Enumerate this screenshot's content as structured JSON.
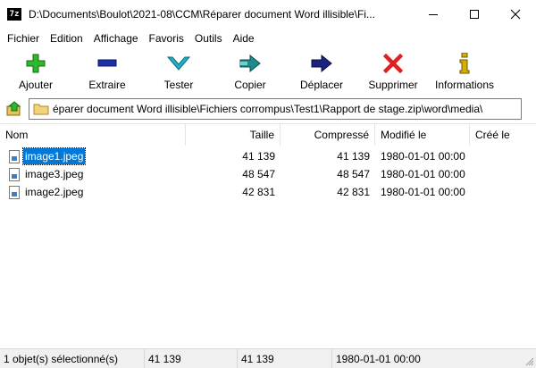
{
  "window": {
    "title": "D:\\Documents\\Boulot\\2021-08\\CCM\\Réparer document Word illisible\\Fi...",
    "app_icon_text": "7z"
  },
  "menu": [
    "Fichier",
    "Edition",
    "Affichage",
    "Favoris",
    "Outils",
    "Aide"
  ],
  "toolbar": [
    {
      "label": "Ajouter",
      "icon": "plus-icon",
      "color": "#2db82d"
    },
    {
      "label": "Extraire",
      "icon": "minus-icon",
      "color": "#1a2fa8"
    },
    {
      "label": "Tester",
      "icon": "check-icon",
      "color": "#20b0c8"
    },
    {
      "label": "Copier",
      "icon": "double-arrow-icon",
      "color": "#1f8a8a"
    },
    {
      "label": "Déplacer",
      "icon": "arrow-icon",
      "color": "#1a237e"
    },
    {
      "label": "Supprimer",
      "icon": "x-icon",
      "color": "#e02020"
    },
    {
      "label": "Informations",
      "icon": "info-icon",
      "color": "#d4b000"
    }
  ],
  "address": {
    "path": "éparer document Word illisible\\Fichiers corrompus\\Test1\\Rapport de stage.zip\\word\\media\\"
  },
  "columns": {
    "name": "Nom",
    "size": "Taille",
    "packed": "Compressé",
    "modified": "Modifié le",
    "created": "Créé le"
  },
  "files": [
    {
      "name": "image1.jpeg",
      "size": "41 139",
      "packed": "41 139",
      "modified": "1980-01-01 00:00",
      "selected": true
    },
    {
      "name": "image3.jpeg",
      "size": "48 547",
      "packed": "48 547",
      "modified": "1980-01-01 00:00",
      "selected": false
    },
    {
      "name": "image2.jpeg",
      "size": "42 831",
      "packed": "42 831",
      "modified": "1980-01-01 00:00",
      "selected": false
    }
  ],
  "status": {
    "selection": "1 objet(s) sélectionné(s)",
    "size": "41 139",
    "packed": "41 139",
    "modified": "1980-01-01 00:00"
  }
}
